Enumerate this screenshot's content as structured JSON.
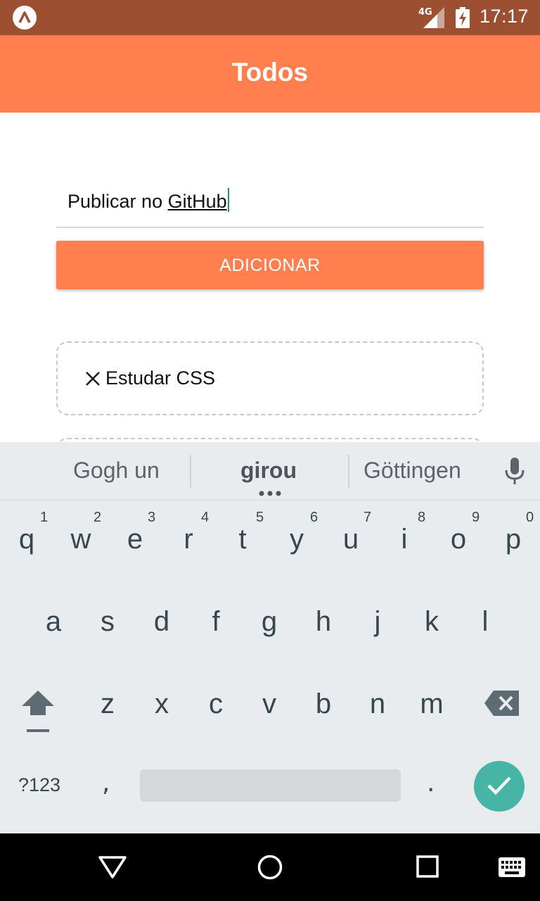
{
  "status_bar": {
    "network": "4G",
    "time": "17:17",
    "color": "#9c4f31"
  },
  "header": {
    "title": "Todos",
    "color": "#ff7f4f"
  },
  "form": {
    "input_value_plain": "Publicar no ",
    "input_value_underlined": "GitHub",
    "add_button_label": "ADICIONAR"
  },
  "todos": [
    {
      "label": "Estudar CSS",
      "icon": "close-icon"
    },
    {
      "label": "",
      "icon": ""
    }
  ],
  "keyboard": {
    "suggestions": [
      "Gogh un",
      "girou",
      "Göttingen"
    ],
    "row1": [
      "q",
      "w",
      "e",
      "r",
      "t",
      "y",
      "u",
      "i",
      "o",
      "p"
    ],
    "row1_hints": [
      "1",
      "2",
      "3",
      "4",
      "5",
      "6",
      "7",
      "8",
      "9",
      "0"
    ],
    "row2": [
      "a",
      "s",
      "d",
      "f",
      "g",
      "h",
      "j",
      "k",
      "l"
    ],
    "row3": [
      "z",
      "x",
      "c",
      "v",
      "b",
      "n",
      "m"
    ],
    "symbols_label": "?123",
    "comma": ",",
    "period": ".",
    "enter_color": "#46b5a6"
  },
  "nav_bar": {
    "icons": [
      "back-icon",
      "home-icon",
      "recents-icon",
      "keyboard-switch-icon"
    ]
  }
}
